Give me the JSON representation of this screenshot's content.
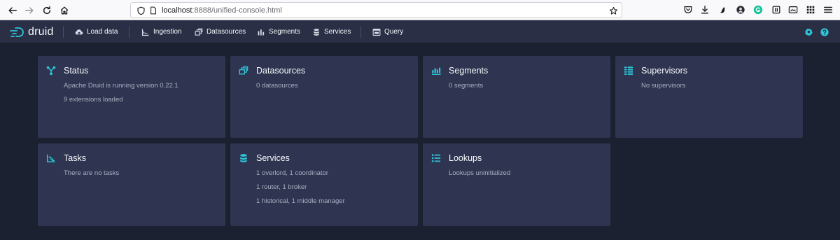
{
  "browser": {
    "url_host": "localhost",
    "url_path": ":8888/unified-console.html"
  },
  "header": {
    "logo_text": "druid",
    "nav": [
      {
        "label": "Load data",
        "icon": "cloud-upload-icon"
      },
      {
        "label": "Ingestion",
        "icon": "ingestion-chart-icon"
      },
      {
        "label": "Datasources",
        "icon": "datasources-icon"
      },
      {
        "label": "Segments",
        "icon": "segments-icon"
      },
      {
        "label": "Services",
        "icon": "database-icon"
      },
      {
        "label": "Query",
        "icon": "query-window-icon"
      }
    ],
    "right_icons": [
      "settings-icon",
      "help-icon"
    ]
  },
  "cards": [
    {
      "title": "Status",
      "icon": "status-icon",
      "lines": [
        "Apache Druid is running version 0.22.1",
        "9 extensions loaded"
      ]
    },
    {
      "title": "Datasources",
      "icon": "datasources-icon",
      "lines": [
        "0 datasources"
      ]
    },
    {
      "title": "Segments",
      "icon": "segments-icon",
      "lines": [
        "0 segments"
      ]
    },
    {
      "title": "Supervisors",
      "icon": "supervisors-icon",
      "lines": [
        "No supervisors"
      ]
    },
    {
      "title": "Tasks",
      "icon": "tasks-icon",
      "lines": [
        "There are no tasks"
      ]
    },
    {
      "title": "Services",
      "icon": "database-icon",
      "lines": [
        "1 overlord, 1 coordinator",
        "1 router, 1 broker",
        "1 historical, 1 middle manager"
      ]
    },
    {
      "title": "Lookups",
      "icon": "lookups-icon",
      "lines": [
        "Lookups uninitialized"
      ]
    }
  ],
  "colors": {
    "accent": "#2ec4d6",
    "page_bg": "#1c2131",
    "card_bg": "#2f3451",
    "nav_bg": "#2a2f45"
  }
}
